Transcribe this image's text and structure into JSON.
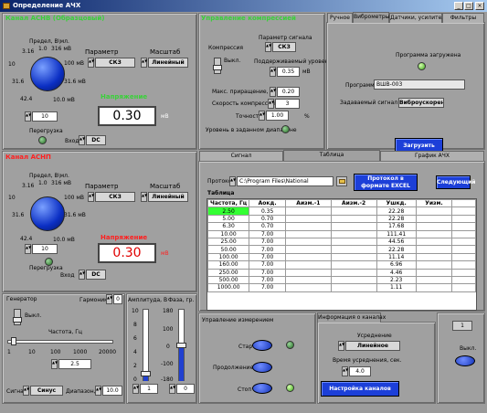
{
  "window": {
    "title": "Определение АЧХ",
    "btns": [
      "_",
      "□",
      "×"
    ]
  },
  "chA": {
    "title": "Канал АСНВ (Образцовый)",
    "range_label": "Предел, В\\мл.",
    "ticks": [
      "3.16",
      "1.0",
      "316 мВ",
      "10",
      "100 мВ",
      "31.6 мВ",
      "31.6",
      "42.4",
      "10.0 мВ"
    ],
    "param_label": "Параметр",
    "param": "СКЗ",
    "scale_label": "Масштаб",
    "scale": "Линейный",
    "voltage_label": "Напряжение",
    "value": "0.30",
    "unit": "мВ",
    "overload_label": "Перегрузка",
    "input_label": "Вход",
    "input": "DC",
    "range_value": "10"
  },
  "chB": {
    "title": "Канал АСНП",
    "range_label": "Предел, В\\мл.",
    "ticks": [
      "3.16",
      "1.0",
      "316 мВ",
      "10",
      "100 мВ",
      "31.6 мВ",
      "31.6",
      "42.4",
      "10.0 мВ"
    ],
    "param_label": "Параметр",
    "param": "СКЗ",
    "scale_label": "Масштаб",
    "scale": "Линейный",
    "voltage_label": "Напряжение",
    "value": "0.30",
    "unit": "мВ",
    "overload_label": "Перегрузка",
    "input_label": "Вход",
    "input": "DC",
    "range_value": "10"
  },
  "comp": {
    "title": "Управление компрессией",
    "signal_param_label": "Параметр сигнала",
    "signal_param": "СКЗ",
    "compression_label": "Компрессия",
    "switch_label": "Выкл.",
    "level_label": "Поддерживаемый уровень",
    "level": "0.35",
    "level_unit": "мВ",
    "max_inc_label": "Макс. приращение, В",
    "max_inc": "0.20",
    "speed_label": "Скорость компрессии",
    "speed": "3",
    "accuracy_label": "Точность",
    "accuracy": "1.00",
    "accuracy_unit": "%",
    "in_range_label": "Уровень в заданном диапазоне"
  },
  "topTabs": [
    "Ручное",
    "Виброметры",
    "Датчики, усилители",
    "Фильтры"
  ],
  "prog": {
    "loaded_label": "Программа загружена",
    "program_label": "Программа",
    "program": "ВШВ-003",
    "signal_label": "Задаваемый сигнал",
    "signal": "Виброускорение",
    "load_btn": "Загрузить"
  },
  "midTabs": [
    "Сигнал",
    "Таблица",
    "График АЧХ"
  ],
  "protocol": {
    "label": "Протокол",
    "path": "C:\\Program Files\\National",
    "excel_btn": "Протокол в формате EXCEL",
    "next_btn": "Следующий",
    "table_label": "Таблица"
  },
  "table": {
    "headers": [
      "Частота, Гц",
      "Аокд.",
      "Аизм.-1",
      "Аизм.-2",
      "Ушкд.",
      "Уизм."
    ],
    "rows": [
      [
        "2.50",
        "0.35",
        "",
        "",
        "22.28",
        ""
      ],
      [
        "5.00",
        "0.70",
        "",
        "",
        "22.28",
        ""
      ],
      [
        "6.30",
        "0.70",
        "",
        "",
        "17.68",
        ""
      ],
      [
        "10.00",
        "7.00",
        "",
        "",
        "111.41",
        ""
      ],
      [
        "25.00",
        "7.00",
        "",
        "",
        "44.56",
        ""
      ],
      [
        "50.00",
        "7.00",
        "",
        "",
        "22.28",
        ""
      ],
      [
        "100.00",
        "7.00",
        "",
        "",
        "11.14",
        ""
      ],
      [
        "160.00",
        "7.00",
        "",
        "",
        "6.96",
        ""
      ],
      [
        "250.00",
        "7.00",
        "",
        "",
        "4.46",
        ""
      ],
      [
        "500.00",
        "7.00",
        "",
        "",
        "2.23",
        ""
      ],
      [
        "1000.00",
        "7.00",
        "",
        "",
        "1.11",
        ""
      ]
    ]
  },
  "gen": {
    "title": "Генератор",
    "harmonic_label": "Гармоника",
    "harmonic": "0",
    "switch_label": "Выкл.",
    "freq_label": "Частота, Гц",
    "freq_ticks": [
      "1",
      "10",
      "100",
      "1000",
      "20000"
    ],
    "freq": "2.5",
    "signal_label": "Сигнал",
    "signal": "Синус",
    "range_label": "Диапазон, В",
    "range": "10.0",
    "amp_label": "Амплитуда, В",
    "amp_ticks": [
      "10",
      "8",
      "6",
      "4",
      "2",
      "0"
    ],
    "amp": "1",
    "amp_fill": 0.1,
    "phase_label": "Фаза, гр.",
    "phase_ticks": [
      "180",
      "100",
      "0",
      "-100",
      "-180"
    ],
    "phase": "0"
  },
  "meas": {
    "title": "Управление измерением",
    "start": "Старт",
    "cont": "Продолжение",
    "stop": "Стоп"
  },
  "info": {
    "title": "Информация о каналах",
    "avg_label": "Усреднение",
    "avg": "Линейное",
    "time_label": "Время усреднения, сек.",
    "time": "4.0",
    "setup_btn": "Настройка каналов"
  },
  "side": {
    "counter": "1",
    "switch_label": "Выкл."
  }
}
